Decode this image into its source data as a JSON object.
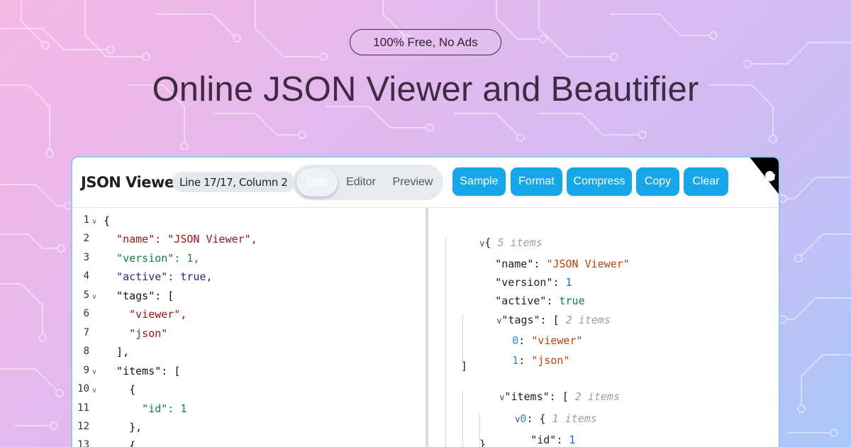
{
  "hero": {
    "badge": "100% Free, No Ads",
    "headline": "Online JSON Viewer and Beautifier"
  },
  "toolbar": {
    "app_title": "JSON Viewer",
    "status": "Line 17/17, Column 2",
    "view_modes": [
      {
        "label": "Split",
        "active": true
      },
      {
        "label": "Editor",
        "active": false
      },
      {
        "label": "Preview",
        "active": false
      }
    ],
    "actions": [
      {
        "label": "Sample"
      },
      {
        "label": "Format"
      },
      {
        "label": "Compress"
      },
      {
        "label": "Copy"
      },
      {
        "label": "Clear"
      }
    ],
    "corner_icon": "github-icon"
  },
  "editor": {
    "lines": [
      {
        "num": "1",
        "fold": true,
        "text": "{"
      },
      {
        "num": "2",
        "fold": false,
        "text": "  \"name\": \"JSON Viewer\","
      },
      {
        "num": "3",
        "fold": false,
        "text": "  \"version\": 1,"
      },
      {
        "num": "4",
        "fold": false,
        "text": "  \"active\": true,"
      },
      {
        "num": "5",
        "fold": true,
        "text": "  \"tags\": ["
      },
      {
        "num": "6",
        "fold": false,
        "text": "    \"viewer\","
      },
      {
        "num": "7",
        "fold": false,
        "text": "    \"json\""
      },
      {
        "num": "8",
        "fold": false,
        "text": "  ],"
      },
      {
        "num": "9",
        "fold": true,
        "text": "  \"items\": ["
      },
      {
        "num": "10",
        "fold": true,
        "text": "    {"
      },
      {
        "num": "11",
        "fold": false,
        "text": "      \"id\": 1"
      },
      {
        "num": "12",
        "fold": false,
        "text": "    },"
      },
      {
        "num": "13",
        "fold": false,
        "text": "    {"
      }
    ]
  },
  "tree": {
    "root_count": "5 items",
    "name_key": "\"name\"",
    "name_val": "\"JSON Viewer\"",
    "version_key": "\"version\"",
    "version_val": "1",
    "active_key": "\"active\"",
    "active_val": "true",
    "tags_key": "\"tags\"",
    "tags_count": "2 items",
    "tag0_idx": "0",
    "tag0_val": "\"viewer\"",
    "tag1_idx": "1",
    "tag1_val": "\"json\"",
    "items_key": "\"items\"",
    "items_count": "2 items",
    "item0_idx": "0",
    "item0_count": "1 items",
    "id_key": "\"id\"",
    "id_val": "1"
  },
  "colors": {
    "accent": "#16a6ea",
    "string": "#a31515",
    "number": "#16803c",
    "boolean": "#1f2d99"
  }
}
